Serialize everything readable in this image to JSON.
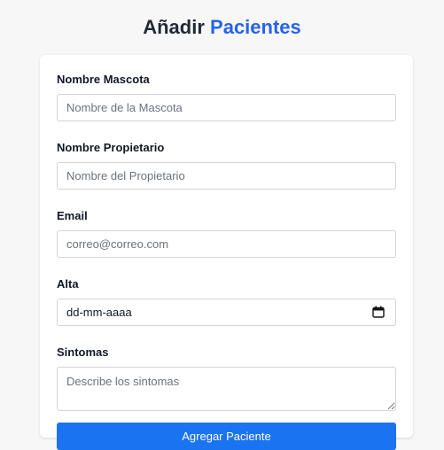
{
  "header": {
    "title_prefix": "Añadir",
    "title_accent": "Pacientes",
    "accent_color": "#2563eb"
  },
  "form": {
    "pet_name": {
      "label": "Nombre Mascota",
      "placeholder": "Nombre de la Mascota",
      "value": ""
    },
    "owner_name": {
      "label": "Nombre Propietario",
      "placeholder": "Nombre del Propietario",
      "value": ""
    },
    "email": {
      "label": "Email",
      "placeholder": "correo@correo.com",
      "value": ""
    },
    "discharge": {
      "label": "Alta",
      "display": "dd-mm-aaaa",
      "icon": "calendar-icon"
    },
    "symptoms": {
      "label": "Sintomas",
      "placeholder": "Describe los sintomas",
      "value": ""
    },
    "submit_label": "Agregar Paciente",
    "button_color": "#1a73f0"
  }
}
